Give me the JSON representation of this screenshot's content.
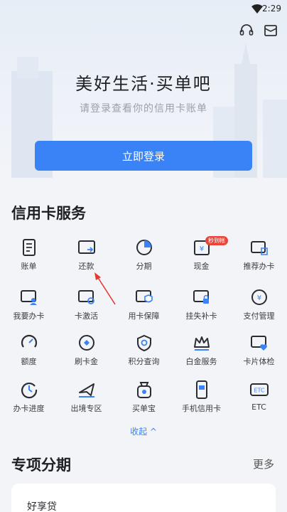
{
  "status_bar": {
    "time": "2:29",
    "wifi_icon": "wifi-icon"
  },
  "header": {
    "headset_icon": "headset-icon",
    "mail_icon": "mail-icon"
  },
  "hero": {
    "title": "美好生活·买单吧",
    "subtitle": "请登录查看你的信用卡账单",
    "login_button": "立即登录"
  },
  "services": {
    "title": "信用卡服务",
    "items": [
      {
        "label": "账单",
        "icon": "bill-icon"
      },
      {
        "label": "还款",
        "icon": "repay-icon"
      },
      {
        "label": "分期",
        "icon": "installment-icon"
      },
      {
        "label": "现金",
        "icon": "cash-icon",
        "badge": "秒到帐"
      },
      {
        "label": "推荐办卡",
        "icon": "recommend-card-icon"
      },
      {
        "label": "我要办卡",
        "icon": "apply-card-icon"
      },
      {
        "label": "卡激活",
        "icon": "activate-card-icon"
      },
      {
        "label": "用卡保障",
        "icon": "card-protection-icon"
      },
      {
        "label": "挂失补卡",
        "icon": "report-loss-icon"
      },
      {
        "label": "支付管理",
        "icon": "payment-settings-icon"
      },
      {
        "label": "额度",
        "icon": "credit-limit-icon"
      },
      {
        "label": "刷卡金",
        "icon": "card-reward-icon"
      },
      {
        "label": "积分查询",
        "icon": "points-icon"
      },
      {
        "label": "白金服务",
        "icon": "crown-icon"
      },
      {
        "label": "卡片体检",
        "icon": "card-checkup-icon"
      },
      {
        "label": "办卡进度",
        "icon": "progress-icon"
      },
      {
        "label": "出境专区",
        "icon": "airplane-icon"
      },
      {
        "label": "买单宝",
        "icon": "bag-icon"
      },
      {
        "label": "手机信用卡",
        "icon": "phone-card-icon"
      },
      {
        "label": "ETC",
        "icon": "etc-icon"
      }
    ],
    "collapse": "收起 ^"
  },
  "special": {
    "title": "专项分期",
    "more": "更多",
    "card_label": "好享贷"
  },
  "accent_color": "#3a83f6",
  "badge_color": "#e8463b"
}
